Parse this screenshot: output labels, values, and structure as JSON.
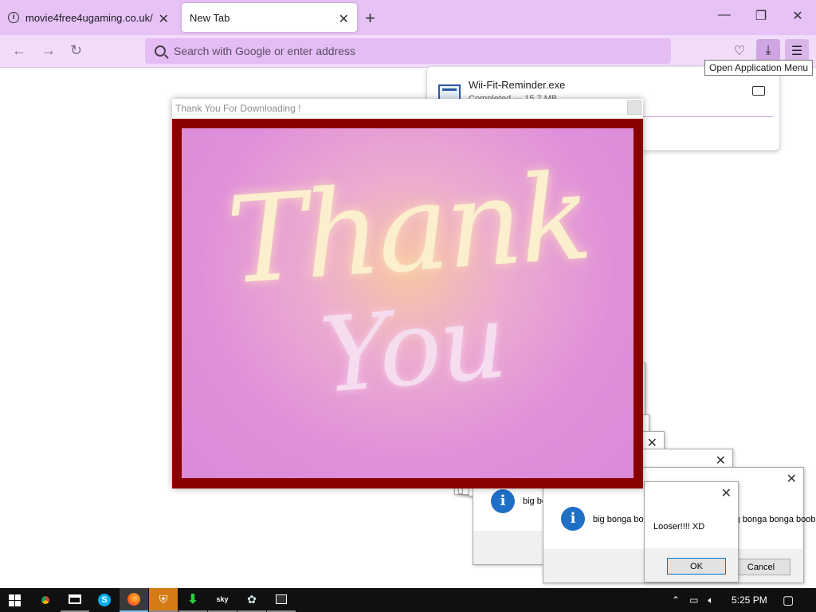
{
  "browser": {
    "tabs": [
      {
        "title": "movie4free4ugaming.co.uk/",
        "active": false
      },
      {
        "title": "New Tab",
        "active": true
      }
    ],
    "urlbar_placeholder": "Search with Google or enter address",
    "tooltip": "Open Application Menu",
    "window_controls": {
      "minimize": "—",
      "maximize": "❐",
      "close": "✕"
    }
  },
  "downloads": {
    "filename": "Wii-Fit-Reminder.exe",
    "status": "Completed — 15.7 MB"
  },
  "thank_you_window": {
    "title": "Thank You For Downloading !",
    "image_text_line1": "Thank",
    "image_text_line2": "You",
    "frame_color": "#8b0000"
  },
  "message_boxes": [
    {
      "text": "big bonga bonga boobies"
    },
    {
      "text": "big bonga bonga boobies"
    },
    {
      "text": "big bonga bonga boobies",
      "cancel_label": "Cancel"
    },
    {
      "text": "Looser!!!! XD",
      "ok_label": "OK"
    }
  ],
  "taskbar": {
    "apps": [
      "chrome-icon",
      "window-icon",
      "skype-icon",
      "firefox-icon",
      "shield-icon",
      "download-app-icon",
      "sky-icon",
      "bird-icon",
      "terminal-icon"
    ],
    "clock": "5:25 PM"
  }
}
